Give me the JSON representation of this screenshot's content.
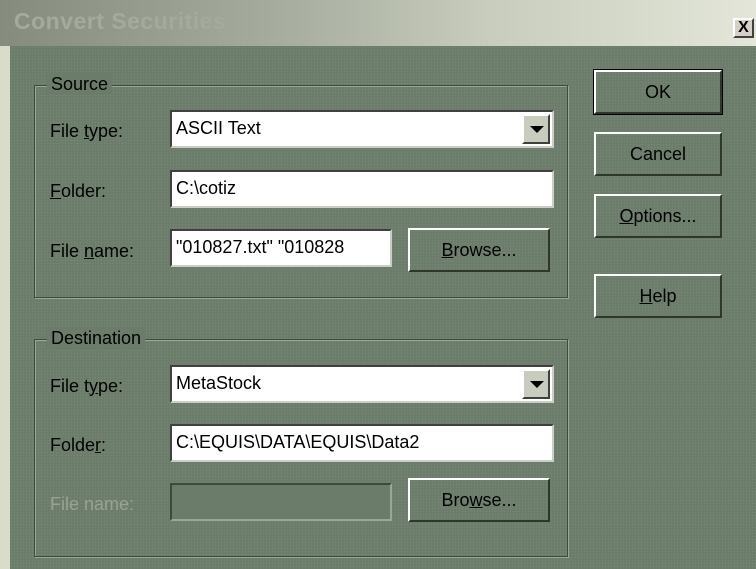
{
  "window": {
    "title": "Convert Securities",
    "close_label": "X"
  },
  "source": {
    "group_label": "Source",
    "file_type": {
      "label_pre": "File ",
      "label_key": "t",
      "label_post": "ype:",
      "value": "ASCII Text"
    },
    "folder": {
      "label_pre": "",
      "label_key": "F",
      "label_post": "older:",
      "value": "C:\\cotiz"
    },
    "file_name": {
      "label_pre": "File ",
      "label_key": "n",
      "label_post": "ame:",
      "value": "\"010827.txt\" \"010828"
    },
    "browse": {
      "pre": "",
      "key": "B",
      "post": "rowse..."
    }
  },
  "destination": {
    "group_label": "Destination",
    "file_type": {
      "label_pre": "File t",
      "label_key": "y",
      "label_post": "pe:",
      "value": "MetaStock"
    },
    "folder": {
      "label_pre": "Folde",
      "label_key": "r",
      "label_post": ":",
      "value": "C:\\EQUIS\\DATA\\EQUIS\\Data2"
    },
    "file_name": {
      "label": "File name:",
      "value": ""
    },
    "browse": {
      "pre": "Bro",
      "key": "w",
      "post": "se..."
    }
  },
  "buttons": {
    "ok": "OK",
    "cancel": "Cancel",
    "options": {
      "pre": "",
      "key": "O",
      "post": "ptions..."
    },
    "help": {
      "pre": "",
      "key": "H",
      "post": "elp"
    }
  },
  "colors": {
    "face": "#6c7c6a",
    "field_bg": "#ffffff",
    "disabled_text": "#9aa392"
  }
}
